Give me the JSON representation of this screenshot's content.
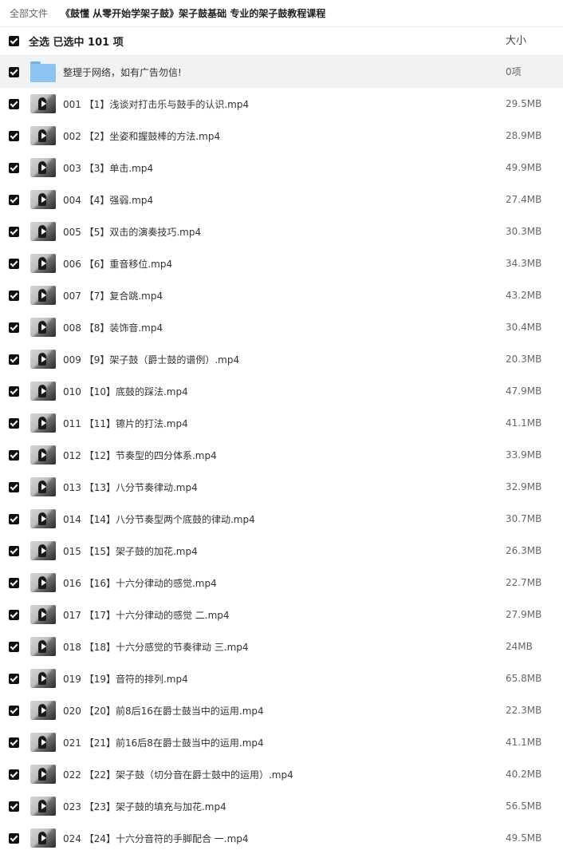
{
  "breadcrumb": {
    "root": "全部文件",
    "path": "《鼓懂 从零开始学架子鼓》架子鼓基础 专业的架子鼓教程课程"
  },
  "header": {
    "select_label": "全选  已选中  101  项",
    "size_col": "大小"
  },
  "folder_row": {
    "name": "整理于网络，如有广告勿信!",
    "size": "0项"
  },
  "files": [
    {
      "name": "001 【1】浅谈对打击乐与鼓手的认识.mp4",
      "size": "29.5MB"
    },
    {
      "name": "002 【2】坐姿和握鼓棒的方法.mp4",
      "size": "28.9MB"
    },
    {
      "name": "003 【3】单击.mp4",
      "size": "49.9MB"
    },
    {
      "name": "004 【4】强弱.mp4",
      "size": "27.4MB"
    },
    {
      "name": "005 【5】双击的演奏技巧.mp4",
      "size": "30.3MB"
    },
    {
      "name": "006 【6】重音移位.mp4",
      "size": "34.3MB"
    },
    {
      "name": "007 【7】复合跳.mp4",
      "size": "43.2MB"
    },
    {
      "name": "008 【8】装饰音.mp4",
      "size": "30.4MB"
    },
    {
      "name": "009 【9】架子鼓（爵士鼓的谱例）.mp4",
      "size": "20.3MB"
    },
    {
      "name": "010 【10】底鼓的踩法.mp4",
      "size": "47.9MB"
    },
    {
      "name": "011 【11】镲片的打法.mp4",
      "size": "41.1MB"
    },
    {
      "name": "012 【12】节奏型的四分体系.mp4",
      "size": "33.9MB"
    },
    {
      "name": "013 【13】八分节奏律动.mp4",
      "size": "32.9MB"
    },
    {
      "name": "014 【14】八分节奏型两个底鼓的律动.mp4",
      "size": "30.7MB"
    },
    {
      "name": "015 【15】架子鼓的加花.mp4",
      "size": "26.3MB"
    },
    {
      "name": "016 【16】十六分律动的感觉.mp4",
      "size": "22.7MB"
    },
    {
      "name": "017 【17】十六分律动的感觉 二.mp4",
      "size": "27.9MB"
    },
    {
      "name": "018 【18】十六分感觉的节奏律动 三.mp4",
      "size": "24MB"
    },
    {
      "name": "019 【19】音符的排列.mp4",
      "size": "65.8MB"
    },
    {
      "name": "020 【20】前8后16在爵士鼓当中的运用.mp4",
      "size": "22.3MB"
    },
    {
      "name": "021 【21】前16后8在爵士鼓当中的运用.mp4",
      "size": "41.1MB"
    },
    {
      "name": "022 【22】架子鼓（切分音在爵士鼓中的运用）.mp4",
      "size": "40.2MB"
    },
    {
      "name": "023 【23】架子鼓的填充与加花.mp4",
      "size": "56.5MB"
    },
    {
      "name": "024 【24】十六分音符的手脚配合 一.mp4",
      "size": "49.5MB"
    }
  ]
}
